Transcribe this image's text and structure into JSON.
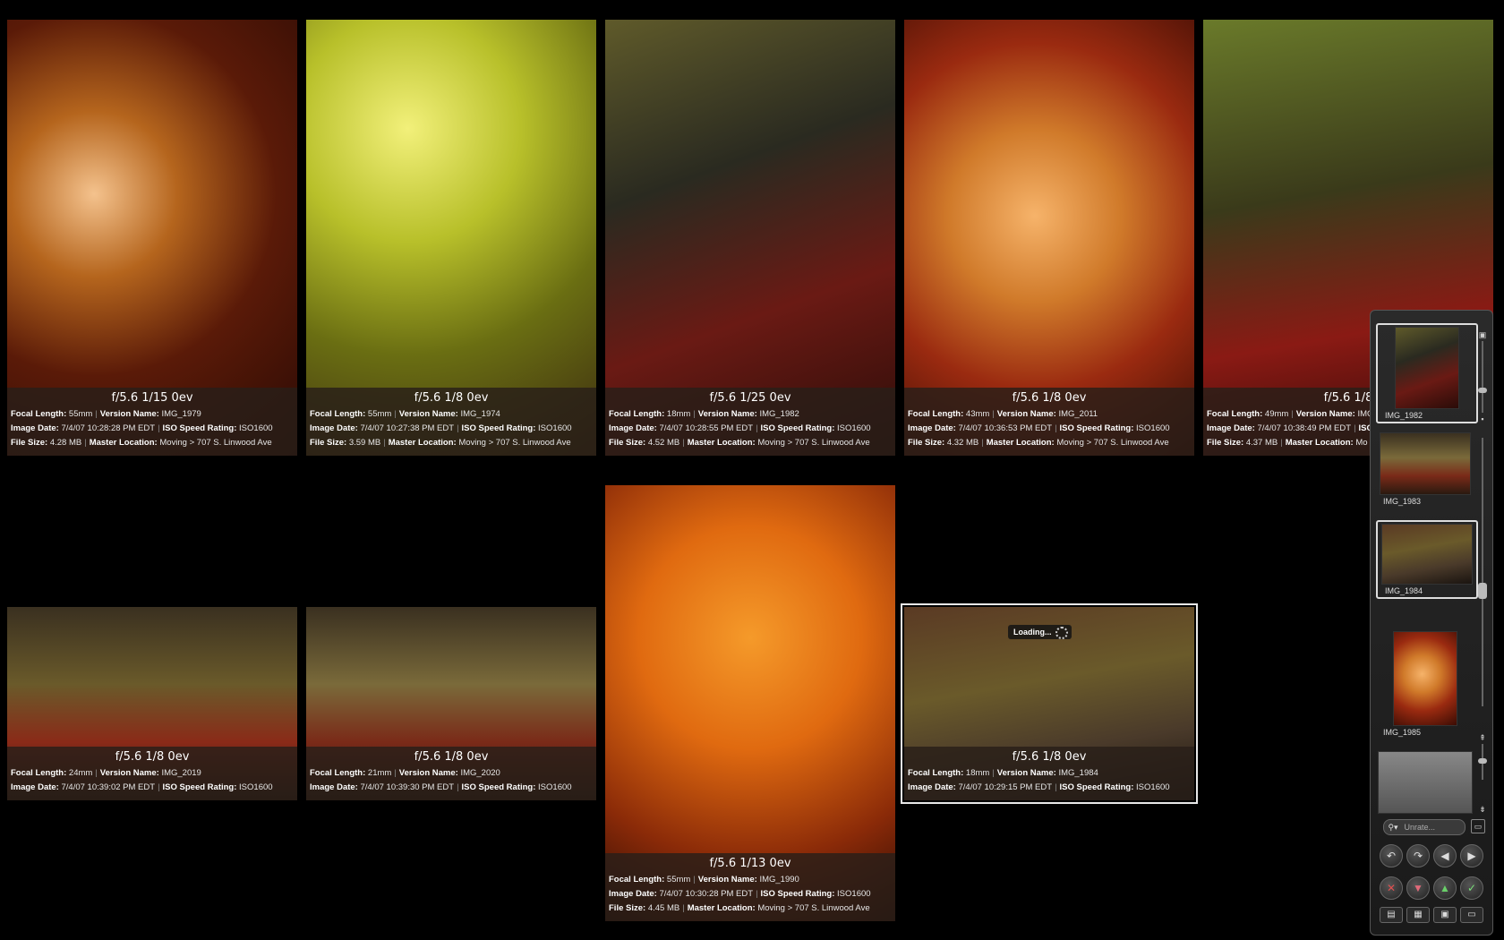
{
  "photos": [
    {
      "exposure": "f/5.6 1/15 0ev",
      "focal": "55mm",
      "version": "IMG_1979",
      "date": "7/4/07 10:28:28 PM EDT",
      "iso": "ISO1600",
      "size": "4.28 MB",
      "location": "Moving > 707 S. Linwood Ave"
    },
    {
      "exposure": "f/5.6 1/8 0ev",
      "focal": "55mm",
      "version": "IMG_1974",
      "date": "7/4/07 10:27:38 PM EDT",
      "iso": "ISO1600",
      "size": "3.59 MB",
      "location": "Moving > 707 S. Linwood Ave"
    },
    {
      "exposure": "f/5.6 1/25 0ev",
      "focal": "18mm",
      "version": "IMG_1982",
      "date": "7/4/07 10:28:55 PM EDT",
      "iso": "ISO1600",
      "size": "4.52 MB",
      "location": "Moving > 707 S. Linwood Ave"
    },
    {
      "exposure": "f/5.6 1/8 0ev",
      "focal": "43mm",
      "version": "IMG_2011",
      "date": "7/4/07 10:36:53 PM EDT",
      "iso": "ISO1600",
      "size": "4.32 MB",
      "location": "Moving > 707 S. Linwood Ave"
    },
    {
      "exposure": "f/5.6 1/8",
      "focal": "49mm",
      "version": "IMG",
      "date": "7/4/07 10:38:49 PM EDT",
      "iso": "IS",
      "size": "4.37 MB",
      "location": "Mo"
    },
    {
      "exposure": "f/5.6 1/8 0ev",
      "focal": "24mm",
      "version": "IMG_2019",
      "date": "7/4/07 10:39:02 PM EDT",
      "iso": "ISO1600"
    },
    {
      "exposure": "f/5.6 1/8 0ev",
      "focal": "21mm",
      "version": "IMG_2020",
      "date": "7/4/07 10:39:30 PM EDT",
      "iso": "ISO1600"
    },
    {
      "exposure": "f/5.6 1/13 0ev",
      "focal": "55mm",
      "version": "IMG_1990",
      "date": "7/4/07 10:30:28 PM EDT",
      "iso": "ISO1600",
      "size": "4.45 MB",
      "location": "Moving > 707 S. Linwood Ave"
    },
    {
      "exposure": "f/5.6 1/8 0ev",
      "focal": "18mm",
      "version": "IMG_1984",
      "date": "7/4/07 10:29:15 PM EDT",
      "iso": "ISO1600"
    }
  ],
  "labels": {
    "focal": "Focal Length:",
    "version": "Version Name:",
    "date": "Image Date:",
    "iso": "ISO Speed Rating:",
    "size": "File Size:",
    "location": "Master Location:"
  },
  "loading_text": "Loading...",
  "filmstrip": {
    "thumbs": [
      {
        "caption": "IMG_1982"
      },
      {
        "caption": "IMG_1983"
      },
      {
        "caption": "IMG_1984"
      },
      {
        "caption": "IMG_1985"
      }
    ],
    "rating_placeholder": "Unrate..."
  },
  "icons": {
    "rotate_left": "↶",
    "rotate_right": "↷",
    "prev": "◀",
    "next": "▶",
    "reject": "✕",
    "decrease": "▼",
    "increase": "▲",
    "accept": "✓",
    "rating_search": "⚲▾",
    "rating_window": "▭"
  }
}
